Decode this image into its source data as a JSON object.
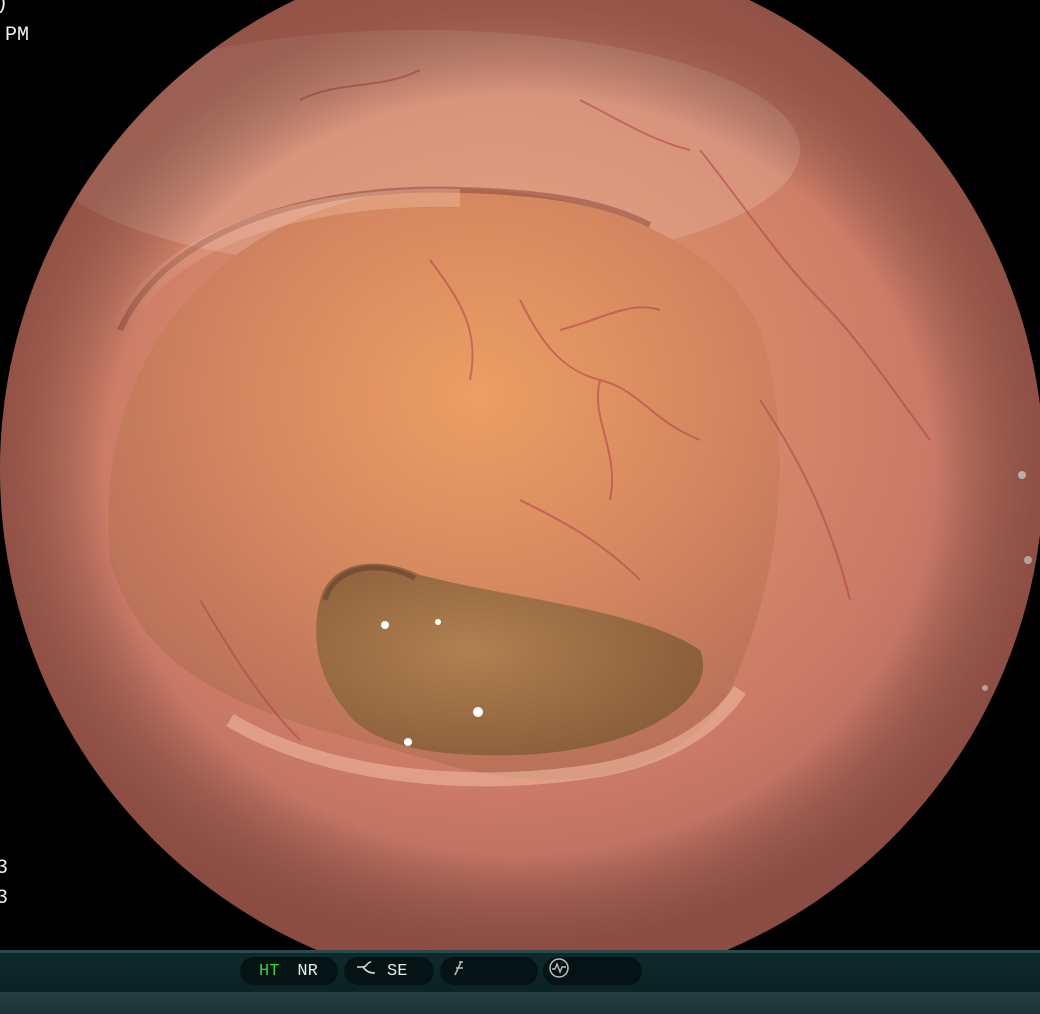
{
  "osd": {
    "top_left_line1": ")",
    "top_left_line2": "PM",
    "bottom_left_line1": "3",
    "bottom_left_line2": "3"
  },
  "status_bar": {
    "ht_label": "HT",
    "nr_label": "NR",
    "se_label": "SE",
    "ht_color": "#39d33f",
    "icons": [
      "enhancement-curve-icon",
      "flat-f-icon",
      "waveform-circle-icon"
    ]
  }
}
